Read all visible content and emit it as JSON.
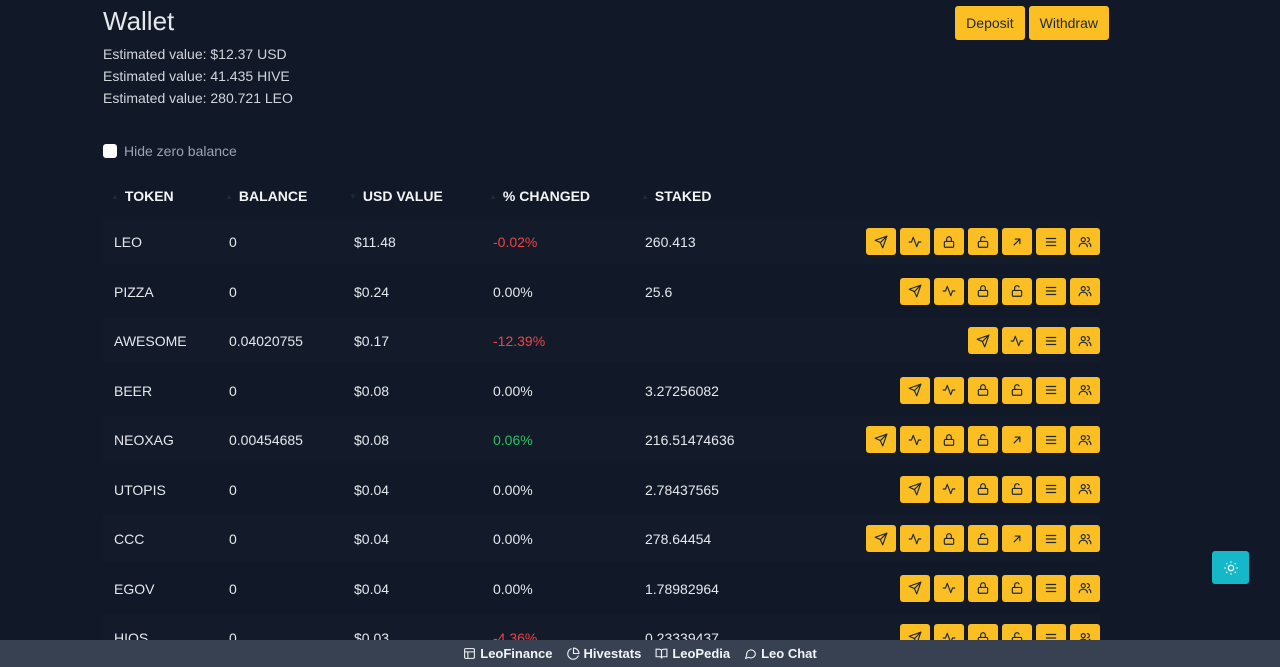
{
  "wallet": {
    "title": "Wallet",
    "estimates": [
      "Estimated value: $12.37 USD",
      "Estimated value: 41.435 HIVE",
      "Estimated value: 280.721 LEO"
    ],
    "deposit_label": "Deposit",
    "withdraw_label": "Withdraw",
    "hide_zero_label": "Hide zero balance"
  },
  "table": {
    "headers": [
      "TOKEN",
      "BALANCE",
      "USD VALUE",
      "% CHANGED",
      "STAKED"
    ],
    "rows": [
      {
        "token": "LEO",
        "balance": "0",
        "usd": "$11.48",
        "change": "-0.02%",
        "change_type": "neg",
        "staked": "260.413",
        "actions": [
          "send",
          "chart",
          "lock",
          "unlock",
          "arrow",
          "menu",
          "users"
        ]
      },
      {
        "token": "PIZZA",
        "balance": "0",
        "usd": "$0.24",
        "change": "0.00%",
        "change_type": "zero",
        "staked": "25.6",
        "actions": [
          "send",
          "chart",
          "lock",
          "unlock",
          "menu",
          "users"
        ]
      },
      {
        "token": "AWESOME",
        "balance": "0.04020755",
        "usd": "$0.17",
        "change": "-12.39%",
        "change_type": "neg",
        "staked": "",
        "actions": [
          "send",
          "chart",
          "menu",
          "users"
        ]
      },
      {
        "token": "BEER",
        "balance": "0",
        "usd": "$0.08",
        "change": "0.00%",
        "change_type": "zero",
        "staked": "3.27256082",
        "actions": [
          "send",
          "chart",
          "lock",
          "unlock",
          "menu",
          "users"
        ]
      },
      {
        "token": "NEOXAG",
        "balance": "0.00454685",
        "usd": "$0.08",
        "change": "0.06%",
        "change_type": "pos",
        "staked": "216.51474636",
        "actions": [
          "send",
          "chart",
          "lock",
          "unlock",
          "arrow",
          "menu",
          "users"
        ]
      },
      {
        "token": "UTOPIS",
        "balance": "0",
        "usd": "$0.04",
        "change": "0.00%",
        "change_type": "zero",
        "staked": "2.78437565",
        "actions": [
          "send",
          "chart",
          "lock",
          "unlock",
          "menu",
          "users"
        ]
      },
      {
        "token": "CCC",
        "balance": "0",
        "usd": "$0.04",
        "change": "0.00%",
        "change_type": "zero",
        "staked": "278.64454",
        "actions": [
          "send",
          "chart",
          "lock",
          "unlock",
          "arrow",
          "menu",
          "users"
        ]
      },
      {
        "token": "EGOV",
        "balance": "0",
        "usd": "$0.04",
        "change": "0.00%",
        "change_type": "zero",
        "staked": "1.78982964",
        "actions": [
          "send",
          "chart",
          "lock",
          "unlock",
          "menu",
          "users"
        ]
      },
      {
        "token": "HIOS",
        "balance": "0",
        "usd": "$0.03",
        "change": "-4.36%",
        "change_type": "neg",
        "staked": "0.23339437",
        "actions": [
          "send",
          "chart",
          "lock",
          "unlock",
          "menu",
          "users"
        ]
      }
    ]
  },
  "footer": {
    "links": [
      {
        "label": "LeoFinance",
        "icon": "square-icon"
      },
      {
        "label": "Hivestats",
        "icon": "pie-icon"
      },
      {
        "label": "LeoPedia",
        "icon": "book-icon"
      },
      {
        "label": "Leo Chat",
        "icon": "chat-icon"
      }
    ]
  },
  "colors": {
    "background": "#111827",
    "accent": "#fbbf24",
    "negative": "#ef4444",
    "positive": "#22c55e",
    "theme_toggle": "#14b8c8"
  }
}
